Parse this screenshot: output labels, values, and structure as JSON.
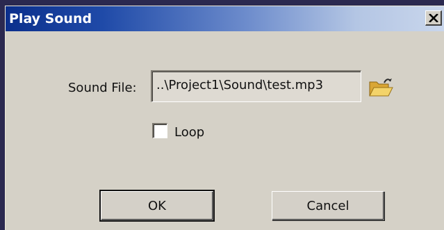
{
  "dialog": {
    "title": "Play Sound",
    "close_icon": "close-icon"
  },
  "sound_file": {
    "label": "Sound File:",
    "value": "..\\Project1\\Sound\\test.mp3",
    "browse_icon": "open-folder-icon"
  },
  "loop": {
    "label": "Loop",
    "checked": false
  },
  "buttons": {
    "ok_label": "OK",
    "cancel_label": "Cancel"
  }
}
